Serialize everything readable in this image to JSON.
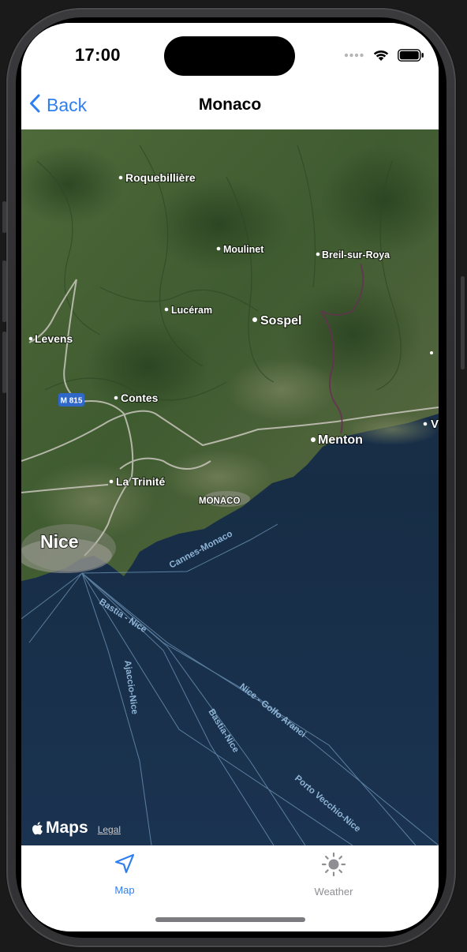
{
  "status_bar": {
    "time": "17:00",
    "icons": [
      "signal-icon",
      "wifi-icon",
      "battery-icon"
    ]
  },
  "nav": {
    "back_label": "Back",
    "title": "Monaco",
    "accent_color": "#2f7ff0"
  },
  "map": {
    "type": "satellite",
    "places": [
      {
        "name": "Roquebillière"
      },
      {
        "name": "Moulinet"
      },
      {
        "name": "Breil-sur-Roya"
      },
      {
        "name": "Lucéram"
      },
      {
        "name": "Sospel"
      },
      {
        "name": "Levens"
      },
      {
        "name": "Contes"
      },
      {
        "name": "Menton"
      },
      {
        "name": "La Trinité"
      },
      {
        "name": "MONACO"
      },
      {
        "name": "Nice"
      }
    ],
    "road_shield": "M 815",
    "ferry_routes": [
      "Cannes-Monaco",
      "Bastia - Nice",
      "Ajaccio-Nice",
      "Nice - Golfo Aranci",
      "Bastia-Nice",
      "Porto Vecchio-Nice"
    ],
    "attribution": {
      "logo_text": "Maps",
      "legal_label": "Legal"
    }
  },
  "tabs": [
    {
      "label": "Map",
      "icon": "location-arrow-icon",
      "selected": true,
      "color": "#2f7ff0"
    },
    {
      "label": "Weather",
      "icon": "sun-icon",
      "selected": false,
      "color": "#8e8e93"
    }
  ]
}
